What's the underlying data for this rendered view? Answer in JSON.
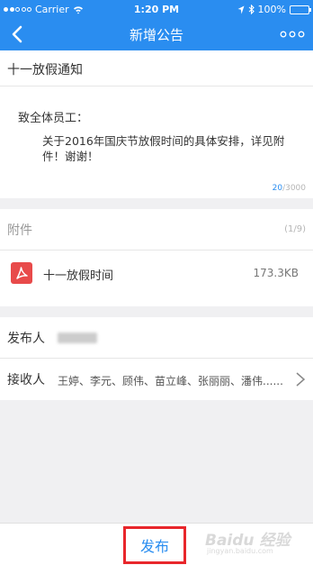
{
  "status_bar": {
    "carrier": "Carrier",
    "time": "1:20 PM",
    "battery": "100%",
    "icons": [
      "signal-icon",
      "wifi-icon",
      "location-icon",
      "bluetooth-icon",
      "battery-icon"
    ]
  },
  "nav": {
    "title": "新增公告",
    "back_icon": "chevron-left-icon",
    "more_icon": "more-dots-icon"
  },
  "notice": {
    "title": "十一放假通知",
    "greeting": "致全体员工：",
    "body": "关于2016年国庆节放假时间的具体安排，详见附件！谢谢！",
    "char_count": "20",
    "char_limit": "/3000"
  },
  "attachments": {
    "label": "附件",
    "count": "(1/9)",
    "files": [
      {
        "name": "十一放假时间",
        "size": "173.3KB",
        "icon": "pdf-icon"
      }
    ]
  },
  "publisher": {
    "label": "发布人"
  },
  "recipients": {
    "label": "接收人",
    "names": "王婷、李元、顾伟、苗立峰、张丽丽、潘伟......"
  },
  "footer": {
    "publish_label": "发布"
  },
  "watermark": {
    "main": "Baidu 经验",
    "sub": "jingyan.baidu.com"
  },
  "colors": {
    "accent": "#2a8df0",
    "highlight_border": "#e8262b",
    "pdf_icon": "#e84a4a"
  }
}
